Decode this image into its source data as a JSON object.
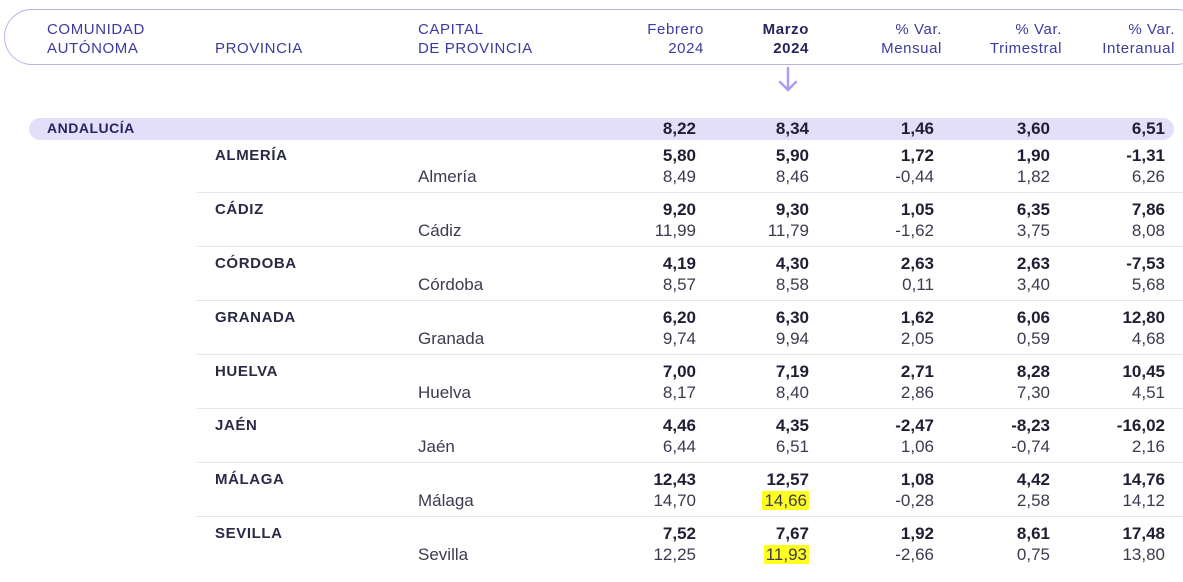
{
  "headers": {
    "comunidad": "COMUNIDAD\nAUTÓNOMA",
    "provincia": "PROVINCIA",
    "capital": "CAPITAL\nDE PROVINCIA",
    "feb": "Febrero\n2024",
    "mar": "Marzo\n2024",
    "var_mensual": "% Var.\nMensual",
    "var_trimestral": "% Var.\nTrimestral",
    "var_interanual": "% Var.\nInteranual"
  },
  "region": {
    "name": "ANDALUCÍA",
    "feb": "8,22",
    "mar": "8,34",
    "mensual": "1,46",
    "trimestral": "3,60",
    "interanual": "6,51"
  },
  "provinces": [
    {
      "name": "ALMERÍA",
      "capital": "Almería",
      "prov": {
        "feb": "5,80",
        "mar": "5,90",
        "mensual": "1,72",
        "trimestral": "1,90",
        "interanual": "-1,31"
      },
      "cap": {
        "feb": "8,49",
        "mar": "8,46",
        "mensual": "-0,44",
        "trimestral": "1,82",
        "interanual": "6,26"
      }
    },
    {
      "name": "CÁDIZ",
      "capital": "Cádiz",
      "prov": {
        "feb": "9,20",
        "mar": "9,30",
        "mensual": "1,05",
        "trimestral": "6,35",
        "interanual": "7,86"
      },
      "cap": {
        "feb": "11,99",
        "mar": "11,79",
        "mensual": "-1,62",
        "trimestral": "3,75",
        "interanual": "8,08"
      }
    },
    {
      "name": "CÓRDOBA",
      "capital": "Córdoba",
      "prov": {
        "feb": "4,19",
        "mar": "4,30",
        "mensual": "2,63",
        "trimestral": "2,63",
        "interanual": "-7,53"
      },
      "cap": {
        "feb": "8,57",
        "mar": "8,58",
        "mensual": "0,11",
        "trimestral": "3,40",
        "interanual": "5,68"
      }
    },
    {
      "name": "GRANADA",
      "capital": "Granada",
      "prov": {
        "feb": "6,20",
        "mar": "6,30",
        "mensual": "1,62",
        "trimestral": "6,06",
        "interanual": "12,80"
      },
      "cap": {
        "feb": "9,74",
        "mar": "9,94",
        "mensual": "2,05",
        "trimestral": "0,59",
        "interanual": "4,68"
      }
    },
    {
      "name": "HUELVA",
      "capital": "Huelva",
      "prov": {
        "feb": "7,00",
        "mar": "7,19",
        "mensual": "2,71",
        "trimestral": "8,28",
        "interanual": "10,45"
      },
      "cap": {
        "feb": "8,17",
        "mar": "8,40",
        "mensual": "2,86",
        "trimestral": "7,30",
        "interanual": "4,51"
      }
    },
    {
      "name": "JAÉN",
      "capital": "Jaén",
      "prov": {
        "feb": "4,46",
        "mar": "4,35",
        "mensual": "-2,47",
        "trimestral": "-8,23",
        "interanual": "-16,02"
      },
      "cap": {
        "feb": "6,44",
        "mar": "6,51",
        "mensual": "1,06",
        "trimestral": "-0,74",
        "interanual": "2,16"
      }
    },
    {
      "name": "MÁLAGA",
      "capital": "Málaga",
      "prov": {
        "feb": "12,43",
        "mar": "12,57",
        "mensual": "1,08",
        "trimestral": "4,42",
        "interanual": "14,76"
      },
      "cap": {
        "feb": "14,70",
        "mar": "14,66",
        "mensual": "-0,28",
        "trimestral": "2,58",
        "interanual": "14,12"
      }
    },
    {
      "name": "SEVILLA",
      "capital": "Sevilla",
      "prov": {
        "feb": "7,52",
        "mar": "7,67",
        "mensual": "1,92",
        "trimestral": "8,61",
        "interanual": "17,48"
      },
      "cap": {
        "feb": "12,25",
        "mar": "11,93",
        "mensual": "-2,66",
        "trimestral": "0,75",
        "interanual": "13,80"
      }
    }
  ],
  "highlighted_cells": [
    "MÁLAGA.cap.mar",
    "SEVILLA.cap.mar"
  ],
  "colors": {
    "accent": "#3d3a9e",
    "region_bar": "#e3dffb",
    "highlight": "#ffff1e"
  }
}
